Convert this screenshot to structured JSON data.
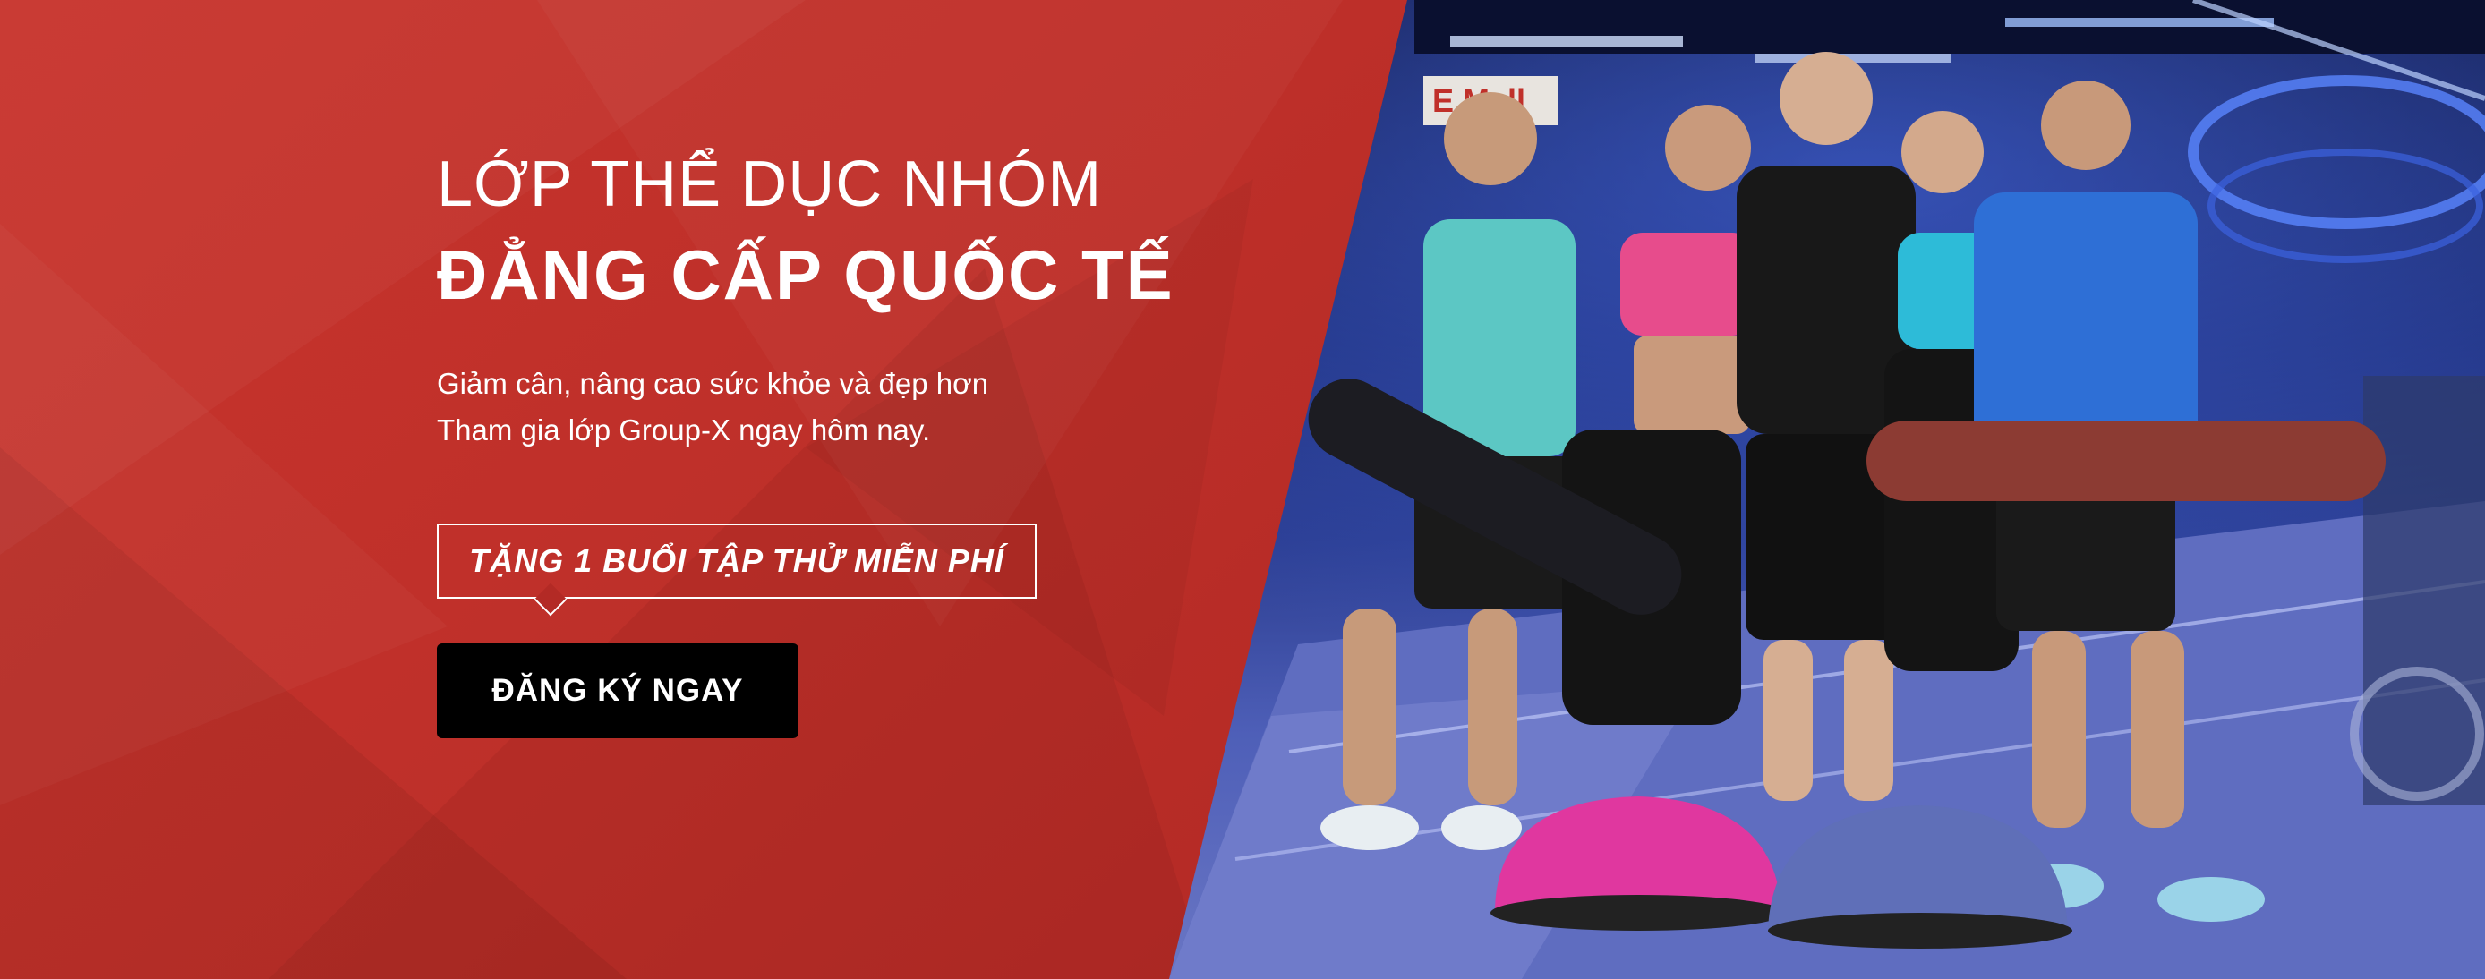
{
  "hero": {
    "headline_line1": "LỚP THỂ DỤC NHÓM",
    "headline_line2": "ĐẲNG CẤP QUỐC TẾ",
    "subtitle_line1": "Giảm cân, nâng cao sức khỏe và đẹp hơn",
    "subtitle_line2": "Tham gia lớp Group-X ngay hôm nay.",
    "promo_label": "TẶNG 1 BUỔI TẬP THỬ MIỄN PHÍ",
    "cta_label": "ĐĂNG KÝ NGAY"
  },
  "photo": {
    "store_sign": "E Mall"
  },
  "colors": {
    "brand_red": "#c8342d",
    "cta_bg": "#000000",
    "text": "#ffffff",
    "ball_pink": "#e0379f",
    "ball_blue": "#5f6fb8"
  }
}
